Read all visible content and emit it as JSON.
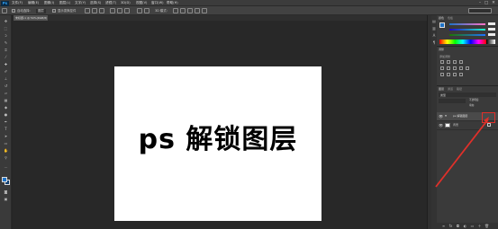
{
  "app": {
    "logo": "Ps"
  },
  "menu": {
    "items": [
      "文件(F)",
      "编辑(E)",
      "图像(I)",
      "图层(L)",
      "文字(Y)",
      "选择(S)",
      "滤镜(T)",
      "3D(D)",
      "视图(V)",
      "窗口(W)",
      "帮助(H)"
    ],
    "window_controls": [
      "–",
      "□",
      "✕"
    ]
  },
  "options_bar": {
    "auto_select_label": "自动选择:",
    "auto_select_value": "图层",
    "show_transform_label": "显示变换控件",
    "mode_label": "3D 模式:"
  },
  "document_tab": {
    "label": "未标题-1 @ 50%(RGB/8)"
  },
  "canvas": {
    "text": "ps 解锁图层",
    "background": "#ffffff"
  },
  "panels": {
    "color_tabs": [
      "颜色",
      "色板"
    ],
    "adjustments_tab": "调整",
    "adjustments_title": "添加调整",
    "layers_tabs": [
      "图层",
      "通道",
      "路径"
    ],
    "layers": [
      {
        "name": "ps 解锁图层",
        "type": "text"
      },
      {
        "name": "背景",
        "type": "background",
        "locked": true
      }
    ],
    "search_label": "类型",
    "opacity_label": "不透明度:",
    "fill_label": "填充:"
  },
  "colors": {
    "accent": "#1e73c8",
    "annotation": "#e0302a"
  }
}
